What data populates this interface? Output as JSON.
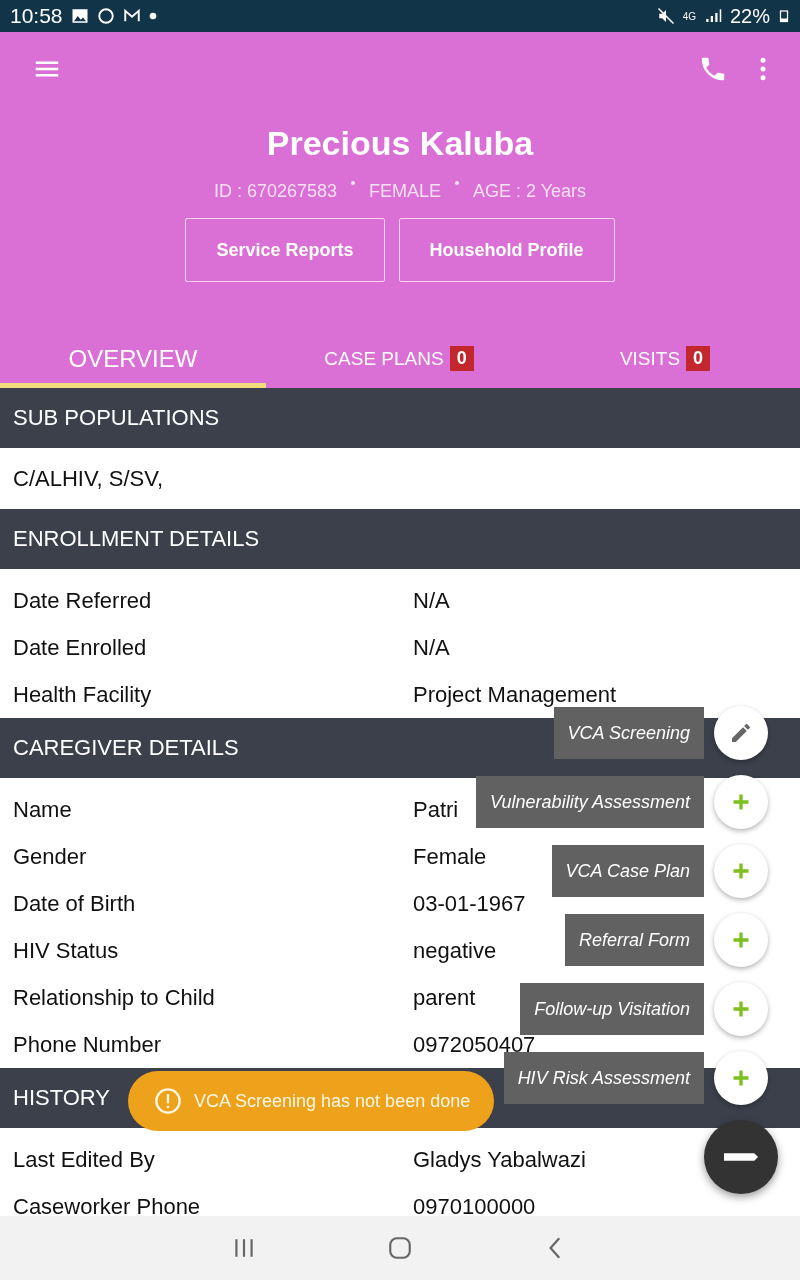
{
  "status_bar": {
    "time": "10:58",
    "network": "4G",
    "battery": "22%"
  },
  "profile": {
    "name": "Precious Kaluba",
    "id": "ID : 670267583",
    "gender": "FEMALE",
    "age": "AGE : 2 Years"
  },
  "buttons": [
    "Service Reports",
    "Household Profile"
  ],
  "tabs": [
    {
      "label": "OVERVIEW",
      "selected": true
    },
    {
      "label": "CASE PLANS",
      "badge": "0",
      "selected": false
    },
    {
      "label": "VISITS",
      "badge": "0",
      "selected": false
    }
  ],
  "sections": [
    {
      "title": "SUB POPULATIONS",
      "kind": "text",
      "text": "C/ALHIV,  S/SV,"
    },
    {
      "title": "ENROLLMENT DETAILS",
      "kind": "fields",
      "rows": [
        {
          "label": "Date Referred",
          "value": "N/A"
        },
        {
          "label": "Date Enrolled",
          "value": "N/A"
        },
        {
          "label": "Health Facility",
          "value": "Project Management"
        }
      ]
    },
    {
      "title": "CAREGIVER DETAILS",
      "kind": "fields",
      "rows": [
        {
          "label": "Name",
          "value": "Patri"
        },
        {
          "label": "Gender",
          "value": "Female"
        },
        {
          "label": "Date of Birth",
          "value": "03-01-1967"
        },
        {
          "label": "HIV Status",
          "value": "negative"
        },
        {
          "label": "Relationship to Child",
          "value": "parent"
        },
        {
          "label": "Phone Number",
          "value": "0972050407"
        }
      ]
    },
    {
      "title": "HISTORY",
      "kind": "fields",
      "rows": [
        {
          "label": "Last Edited By",
          "value": "Gladys Yabalwazi"
        },
        {
          "label": "Caseworker Phone",
          "value": "0970100000"
        }
      ]
    }
  ],
  "fab_actions": [
    {
      "label": "VCA Screening",
      "kind": "edit"
    },
    {
      "label": "Vulnerability Assessment",
      "kind": "add"
    },
    {
      "label": "VCA Case Plan",
      "kind": "add"
    },
    {
      "label": "Referral Form",
      "kind": "add"
    },
    {
      "label": "Follow-up Visitation",
      "kind": "add"
    },
    {
      "label": "HIV Risk Assessment",
      "kind": "add"
    }
  ],
  "toast": {
    "text": "VCA Screening has not been done"
  }
}
